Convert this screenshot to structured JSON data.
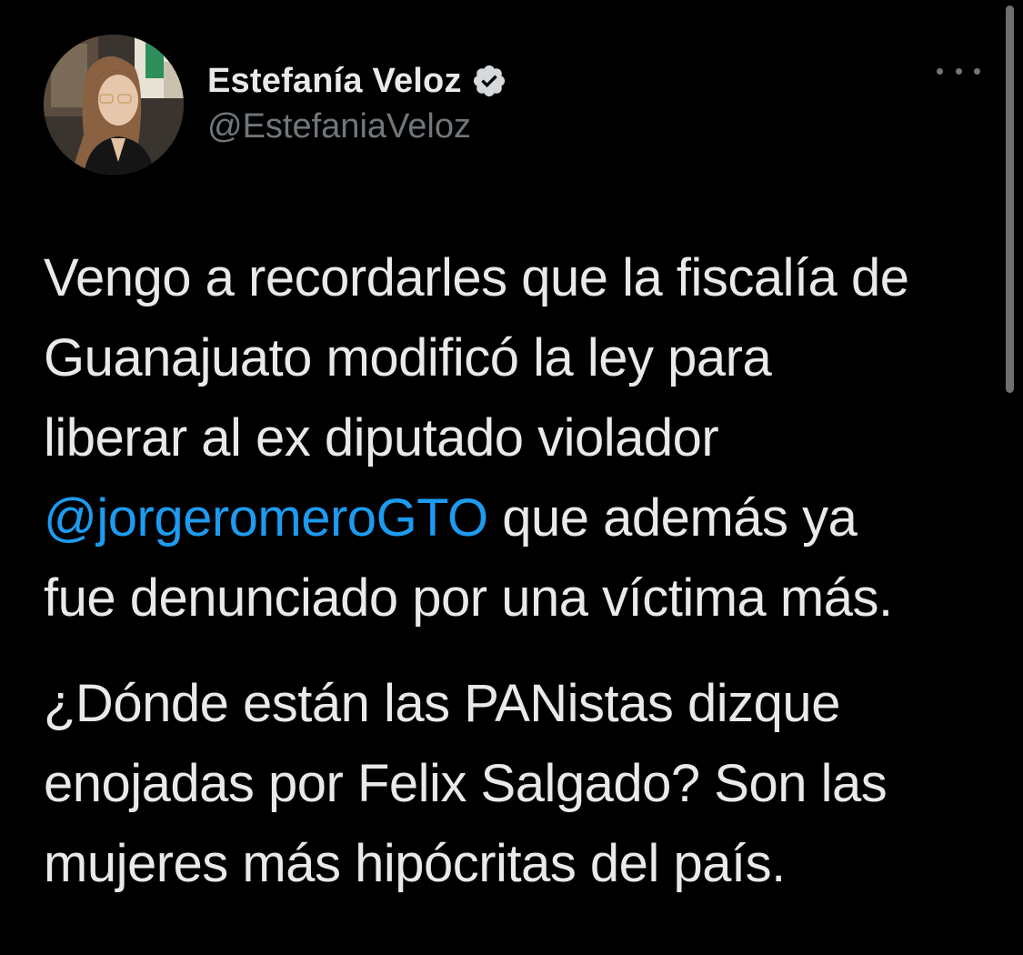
{
  "author": {
    "display_name": "Estefanía Veloz",
    "handle": "@EstefaniaVeloz",
    "verified": true,
    "avatar_icon": "profile-photo"
  },
  "actions": {
    "more_icon": "more-options-icon"
  },
  "tweet": {
    "para1_line1": "Vengo a recordarles que la fiscalía de",
    "para1_line2": "Guanajuato modificó la ley para",
    "para1_line3": "liberar al ex diputado violador",
    "mention": "@jorgeromeroGTO",
    "para1_line4_rest": " que además ya",
    "para1_line5": "fue denunciado por una víctima más.",
    "para2_line1": "¿Dónde están las PANistas dizque",
    "para2_line2": "enojadas por Felix Salgado? Son las",
    "para2_line3": "mujeres más hipócritas del país."
  },
  "colors": {
    "background": "#000000",
    "text": "#e7e9ea",
    "secondary": "#71767b",
    "link": "#1d9bf0"
  }
}
